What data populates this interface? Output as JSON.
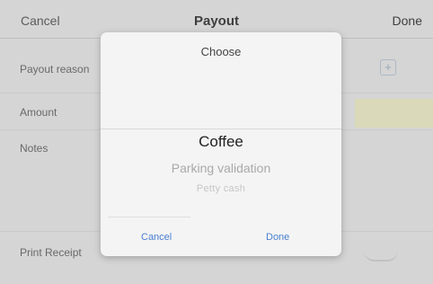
{
  "nav": {
    "cancel": "Cancel",
    "title": "Payout",
    "done": "Done"
  },
  "form": {
    "payout_reason_label": "Payout reason",
    "amount_label": "Amount",
    "notes_label": "Notes",
    "print_receipt_label": "Print Receipt"
  },
  "modal": {
    "title": "Choose",
    "options": [
      "Coffee",
      "Parking validation",
      "Petty cash"
    ],
    "cancel": "Cancel",
    "done": "Done"
  },
  "icons": {
    "add": "plus-square-icon"
  },
  "colors": {
    "accent": "#4a7fd0",
    "amount_highlight": "#f0f0c8"
  }
}
